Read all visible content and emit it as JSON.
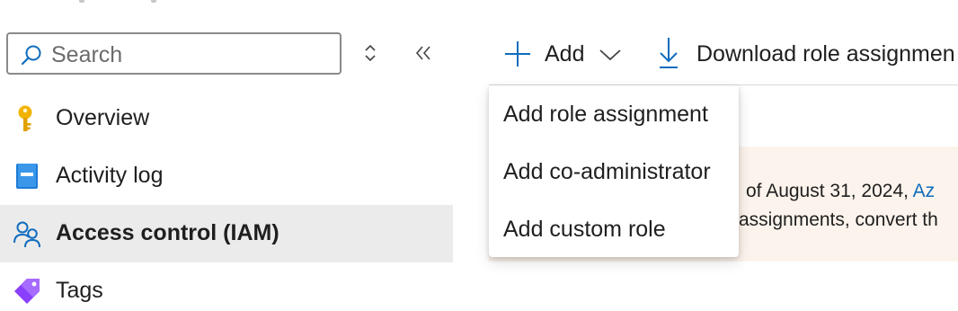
{
  "search": {
    "placeholder": "Search"
  },
  "sidebar": {
    "items": [
      {
        "label": "Overview",
        "icon": "key-icon",
        "active": false
      },
      {
        "label": "Activity log",
        "icon": "activity-log-icon",
        "active": false
      },
      {
        "label": "Access control (IAM)",
        "icon": "people-icon",
        "active": true
      },
      {
        "label": "Tags",
        "icon": "tag-icon",
        "active": false
      }
    ]
  },
  "toolbar": {
    "add_label": "Add",
    "download_label": "Download role assignmen"
  },
  "add_menu": {
    "items": [
      {
        "label": "Add role assignment"
      },
      {
        "label": "Add co-administrator"
      },
      {
        "label": "Add custom role"
      }
    ]
  },
  "banner": {
    "line1_text": "of August 31, 2024,",
    "line1_link": "Az",
    "line2_text": "assignments, convert th"
  },
  "colors": {
    "accent": "#0f6cbd",
    "active_nav_bg": "#ebebeb",
    "banner_bg": "#fcf4ec",
    "key_icon": "#f2b300",
    "tag_icon": "#8a3ffc"
  }
}
